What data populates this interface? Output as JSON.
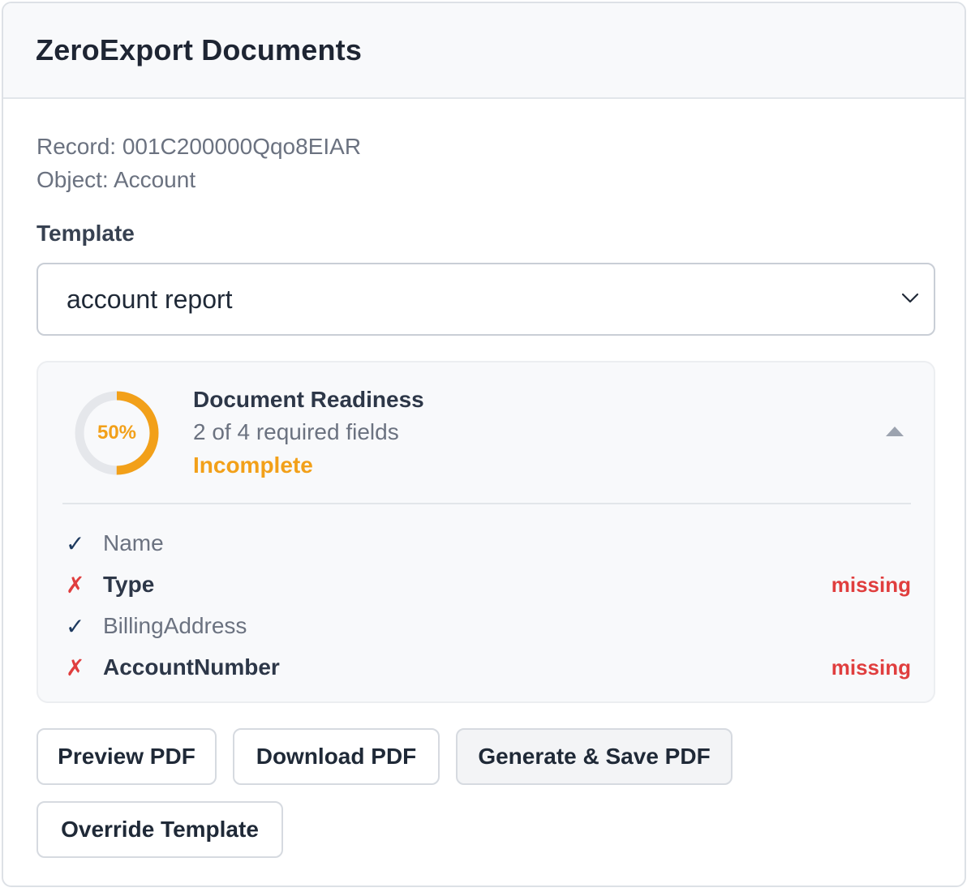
{
  "header": {
    "title": "ZeroExport Documents"
  },
  "meta": {
    "record": "Record: 001C200000Qqo8EIAR",
    "object": "Object: Account"
  },
  "template": {
    "label": "Template",
    "selected": "account report"
  },
  "readiness": {
    "title": "Document Readiness",
    "percent_label": "50%",
    "percent": 0.5,
    "count_text": "2 of 4 required fields",
    "status": "Incomplete",
    "status_color": "#f2a019",
    "fields": [
      {
        "icon": "✓",
        "name": "Name",
        "ok": true,
        "status": ""
      },
      {
        "icon": "✗",
        "name": "Type",
        "ok": false,
        "status": "missing"
      },
      {
        "icon": "✓",
        "name": "BillingAddress",
        "ok": true,
        "status": ""
      },
      {
        "icon": "✗",
        "name": "AccountNumber",
        "ok": false,
        "status": "missing"
      }
    ]
  },
  "actions": {
    "preview": "Preview PDF",
    "download": "Download PDF",
    "generate": "Generate & Save PDF",
    "override": "Override Template"
  },
  "colors": {
    "accent_orange": "#f2a019",
    "error_red": "#e03e3e",
    "check_navy": "#1e3a5f"
  }
}
